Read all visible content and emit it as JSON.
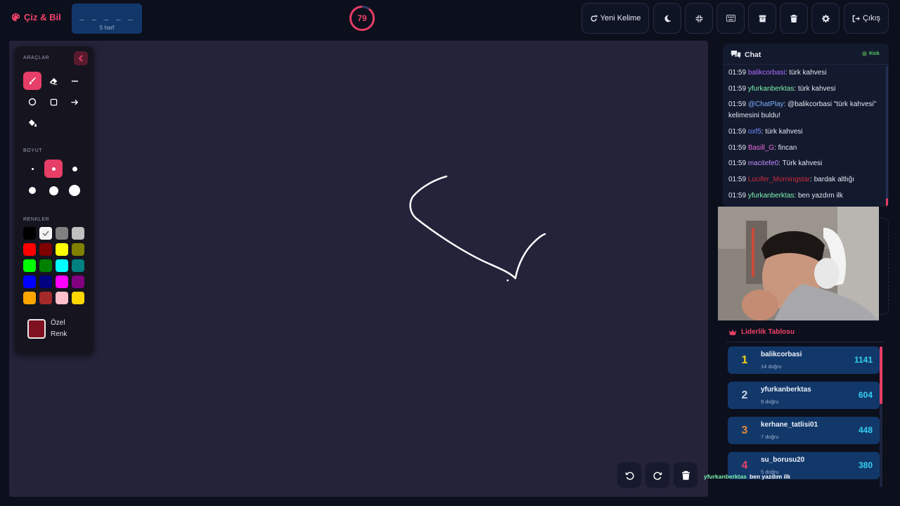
{
  "header": {
    "brand": "Çiz & Bil",
    "word_blanks": "_ _ _ _ _",
    "word_length": "5 harf",
    "timer": "79",
    "timer_progress": 0.1,
    "new_word_label": "Yeni Kelime",
    "logout_label": "Çıkış"
  },
  "tools": {
    "title": "ARAÇLAR",
    "size_title": "BOYUT",
    "colors_title": "RENKLER",
    "custom_color_label": "Özel Renk",
    "custom_color": "#7f1020",
    "palette": [
      "#000000",
      "#f2f2f2",
      "#808080",
      "#c0c0c0",
      "#ff0000",
      "#800000",
      "#ffff00",
      "#808000",
      "#00ff00",
      "#008000",
      "#00ffff",
      "#008080",
      "#0000ff",
      "#000080",
      "#ff00ff",
      "#800080",
      "#ffa500",
      "#a52a2a",
      "#ffc0cb",
      "#ffd700"
    ],
    "active_tool": "brush",
    "active_size": 2
  },
  "chat": {
    "title": "Chat",
    "platform": "Kick",
    "messages": [
      {
        "time": "01:59",
        "user": "balikcorbasi",
        "color": "#b06cff",
        "text": "türk kahvesi"
      },
      {
        "time": "01:59",
        "user": "yfurkanberktas",
        "color": "#7ef3b0",
        "text": "türk kahvesi"
      },
      {
        "time": "01:59",
        "user": "@ChatPlay",
        "color": "#7fb2ff",
        "text": "@balikcorbasi \"türk kahvesi\" kelimesini buldu!"
      },
      {
        "time": "01:59",
        "user": "oxf5",
        "color": "#6b8cff",
        "text": "türk kahvesi"
      },
      {
        "time": "01:59",
        "user": "Basill_G",
        "color": "#e86bd8",
        "text": "fincan"
      },
      {
        "time": "01:59",
        "user": "macitefe0",
        "color": "#c08cff",
        "text": "Türk kahvesi"
      },
      {
        "time": "01:59",
        "user": "Lucifer_Morningstar",
        "color": "#d02a3a",
        "text": "bardak altlığı"
      },
      {
        "time": "01:59",
        "user": "yfurkanberktas",
        "color": "#7ef3b0",
        "text": "ben yazdım ilk"
      }
    ]
  },
  "leaderboard": {
    "title": "Liderlik Tablosu",
    "rows": [
      {
        "rank": "1",
        "rank_color": "#f2d21b",
        "name": "balikcorbasi",
        "correct": "14 doğru",
        "score": "1141"
      },
      {
        "rank": "2",
        "rank_color": "#c9d2e4",
        "name": "yfurkanberktas",
        "correct": "9 doğru",
        "score": "604"
      },
      {
        "rank": "3",
        "rank_color": "#e0883a",
        "name": "kerhane_tatlisi01",
        "correct": "7 doğru",
        "score": "448"
      },
      {
        "rank": "4",
        "rank_color": "#e63e66",
        "name": "su_borusu20",
        "correct": "5 doğru",
        "score": "380"
      }
    ]
  },
  "overlay": {
    "user": "yfurkanberktas",
    "text": "ben yazdım ilk"
  }
}
